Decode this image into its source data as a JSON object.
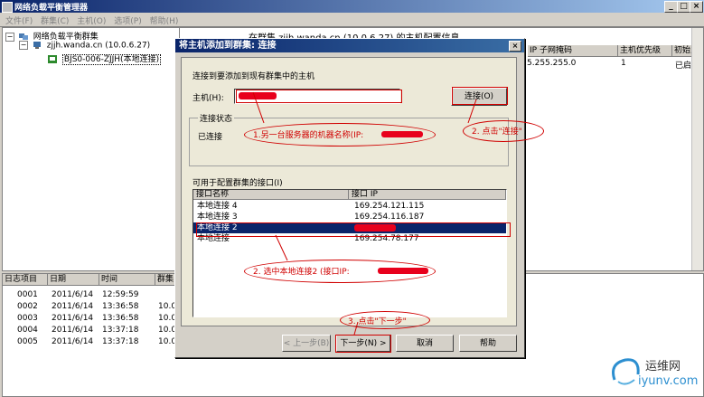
{
  "window": {
    "title": "网络负载平衡管理器",
    "buttons": [
      "_",
      "□",
      "×"
    ]
  },
  "menu": [
    "文件(F)",
    "群集(C)",
    "主机(O)",
    "选项(P)",
    "帮助(H)"
  ],
  "tree": {
    "root": "网络负载平衡群集",
    "cluster": "zjjh.wanda.cn (10.0.6.27)",
    "host": "BJS0-006-ZJJH(本地连接)"
  },
  "right_pane": {
    "caption": "在群集 zjjh.wanda.cn (10.0.6.27) 的主机配置信息",
    "columns": [
      "IP 子网掩码",
      "主机优先级",
      "初始主"
    ],
    "row": [
      "5.255.255.0",
      "1",
      "已启动"
    ]
  },
  "log": {
    "columns": [
      "日志项目",
      "日期",
      "时间",
      "群集"
    ],
    "rows": [
      [
        "0001",
        "2011/6/14",
        "12:59:59",
        ""
      ],
      [
        "0002",
        "2011/6/14",
        "13:36:58",
        "10.0"
      ],
      [
        "0003",
        "2011/6/14",
        "13:36:58",
        "10.0"
      ],
      [
        "0004",
        "2011/6/14",
        "13:37:18",
        "10.0"
      ],
      [
        "0005",
        "2011/6/14",
        "13:37:18",
        "10.0"
      ]
    ]
  },
  "dialog": {
    "title": "将主机添加到群集: 连接",
    "close": "×",
    "instruction": "连接到要添加到现有群集中的主机",
    "host_label": "主机(H):",
    "connect_button": "连接(O)",
    "status_group": "连接状态",
    "status_value": "已连接",
    "interfaces_label": "可用于配置群集的接口(I)",
    "list_columns": [
      "接口名称",
      "接口 IP"
    ],
    "list_rows": [
      [
        "本地连接 4",
        "169.254.121.115"
      ],
      [
        "本地连接 3",
        "169.254.116.187"
      ],
      [
        "本地连接 2",
        ""
      ],
      [
        "本地连接",
        "169.254.78.177"
      ]
    ],
    "selected_index": 2,
    "buttons": {
      "back": "< 上一步(B)",
      "next": "下一步(N) >",
      "cancel": "取消",
      "help": "帮助"
    }
  },
  "annotations": {
    "a1": "1.另一台服务器的机器名称(IP:",
    "a2": "2. 点击\"连接\"",
    "a3": "2. 选中本地连接2 (接口IP:",
    "a4": "3. 点击\"下一步\""
  },
  "watermark": {
    "cn": "运维网",
    "en": "iyunv.com"
  },
  "colors": {
    "titlebar": "#0a246a",
    "annotation": "#d00000",
    "redaction": "#e8001c",
    "selection": "#0a246a"
  }
}
